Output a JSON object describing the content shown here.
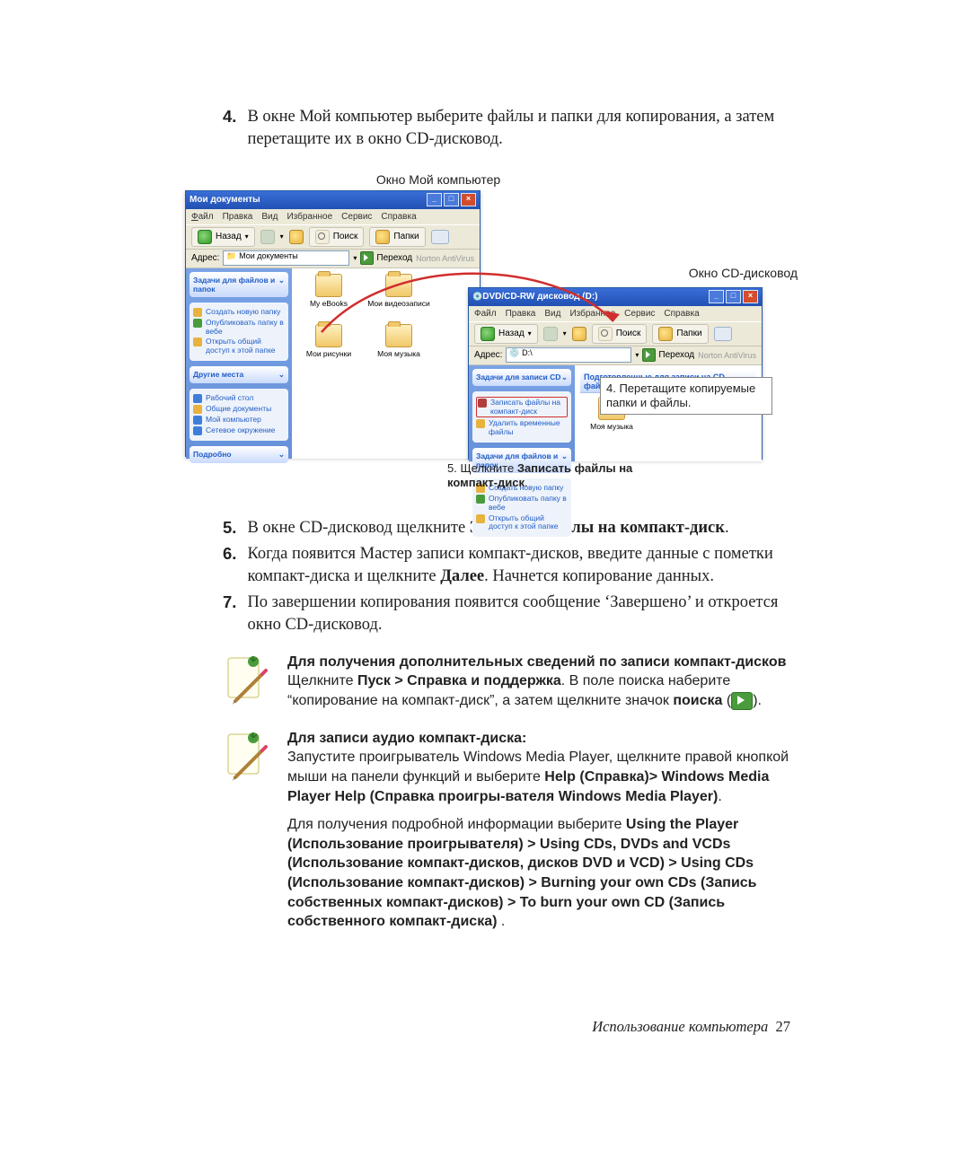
{
  "steps": {
    "s4_num": "4.",
    "s4": "В окне Мой компьютер выберите файлы и папки для копирования, а затем перетащите их в окно CD-дисковод.",
    "s5_num": "5.",
    "s5_a": "В окне CD-дисковод щелкните ",
    "s5_b": "Записать файлы на компакт-диск",
    "s5_c": ".",
    "s6_num": "6.",
    "s6_a": "Когда появится Мастер записи компакт-дисков, введите данные с пометки компакт-диска и щелкните ",
    "s6_b": "Далее",
    "s6_c": ". Начнется копирование данных.",
    "s7_num": "7.",
    "s7": "По завершении копирования появится сообщение ‘Завершено’ и откроется окно CD-дисковод."
  },
  "figure": {
    "title_left": "Окно Мой компьютер",
    "title_right": "Окно CD-дисковод"
  },
  "win1": {
    "title": "Мои документы",
    "menu_file": "Файл",
    "menu_edit": "Правка",
    "menu_view": "Вид",
    "menu_fav": "Избранное",
    "menu_tools": "Сервис",
    "menu_help": "Справка",
    "back": "Назад",
    "search": "Поиск",
    "folders": "Папки",
    "addr_label": "Адрес:",
    "addr_value": "Мои документы",
    "go": "Переход",
    "norton": "Norton AntiVirus",
    "panel1_hd": "Задачи для файлов и папок",
    "p1_i1": "Создать новую папку",
    "p1_i2": "Опубликовать папку в вебе",
    "p1_i3": "Открыть общий доступ к этой папке",
    "panel2_hd": "Другие места",
    "p2_i1": "Рабочий стол",
    "p2_i2": "Общие документы",
    "p2_i3": "Мой компьютер",
    "p2_i4": "Сетевое окружение",
    "panel3_hd": "Подробно",
    "f1": "My eBooks",
    "f2": "Мои видеозаписи",
    "f3": "Мои рисунки",
    "f4": "Моя музыка"
  },
  "win2": {
    "title": "DVD/CD-RW дисковод (D:)",
    "menu_file": "Файл",
    "menu_edit": "Правка",
    "menu_view": "Вид",
    "menu_fav": "Избранное",
    "menu_tools": "Сервис",
    "menu_help": "Справка",
    "back": "Назад",
    "search": "Поиск",
    "folders": "Папки",
    "addr_label": "Адрес:",
    "addr_value": "D:\\",
    "go": "Переход",
    "norton": "Norton AntiVirus",
    "banner": "Подготовленные для записи на CD файлы",
    "panel1_hd": "Задачи для записи CD",
    "p1_i1": "Записать файлы на компакт-диск",
    "p1_i2": "Удалить временные файлы",
    "panel2_hd": "Задачи для файлов и папок",
    "p2_i1": "Создать новую папку",
    "p2_i2": "Опубликовать папку в вебе",
    "p2_i3": "Открыть общий доступ к этой папке",
    "f1": "Моя музыка"
  },
  "callouts": {
    "c4": "4. Перетащите копируемые папки и файлы.",
    "c5_a": "5. Щелкните ",
    "c5_b": "Записать файлы на компакт-диск",
    "c5_c": "."
  },
  "note1": {
    "hd": "Для получения дополнительных сведений по записи компакт-дисков",
    "a": "Щелкните ",
    "b": "Пуск > Справка и поддержка",
    "c": ". В поле поиска наберите “копирование на компакт-диск”, а затем щелкните значок ",
    "d": "поиска",
    "e": " (",
    "f": ")."
  },
  "note2": {
    "hd": "Для записи аудио компакт-диска:",
    "p1_a": "Запустите проигрыватель Windows Media Player, щелкните правой кнопкой мыши на панели функций и выберите ",
    "p1_b": "Help (Справка)> Windows Media Player Help (Справка проигры-вателя Windows Media Player)",
    "p1_c": ".",
    "p2_a": "Для получения подробной информации выберите ",
    "p2_b": "Using the Player (Использование проигрывателя) > Using CDs, DVDs and VCDs (Использование компакт-дисков, дисков DVD и VCD) > Using CDs (Использование компакт-дисков) > Burning your own CDs  (Запись собственных компакт-дисков) > To burn your own CD  (Запись собственного компакт-диска) ",
    "p2_c": "."
  },
  "footer": {
    "text": "Использование компьютера",
    "page": "27"
  }
}
